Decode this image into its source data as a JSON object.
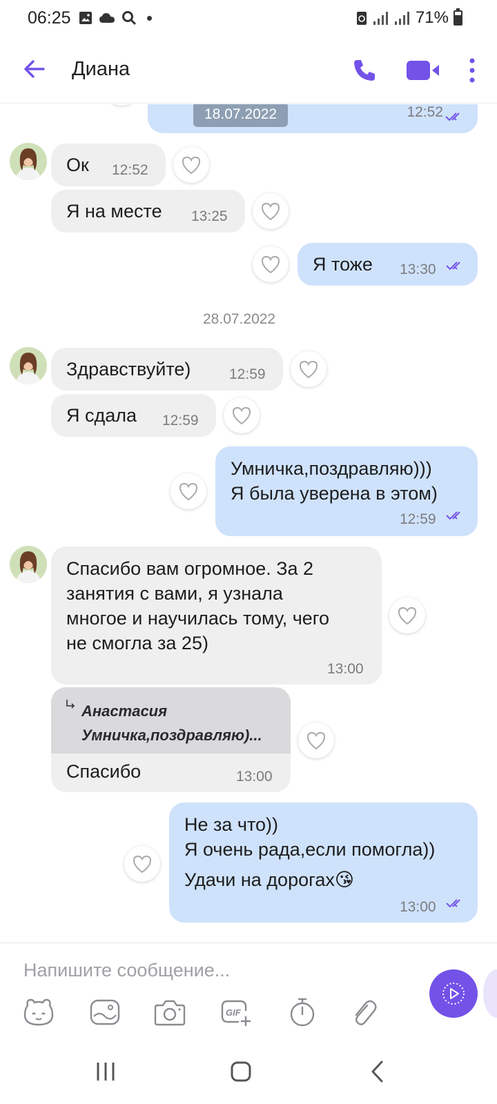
{
  "status_bar": {
    "time": "06:25",
    "battery": "71%",
    "battery_level": 0.71
  },
  "header": {
    "contact_name": "Диана"
  },
  "chat": {
    "top_partial_time": "12:52",
    "date_pill": "18.07.2022",
    "date_separator": "28.07.2022",
    "messages": [
      {
        "text": "Ок",
        "time": "12:52"
      },
      {
        "text": "Я на месте",
        "time": "13:25"
      },
      {
        "text": "Я тоже",
        "time": "13:30"
      },
      {
        "text": "Здравствуйте)",
        "time": "12:59"
      },
      {
        "text": "Я сдала",
        "time": "12:59"
      },
      {
        "lines": [
          "Умничка,поздравляю)))",
          "Я была уверена в этом)"
        ],
        "time": "12:59"
      },
      {
        "lines": [
          "Спасибо вам огромное. За 2",
          "занятия с вами, я узнала",
          "многое и научилась тому, чего",
          "не смогла за 25)"
        ],
        "time": "13:00"
      },
      {
        "reply_author": "Анастасия",
        "reply_preview": "Умничка,поздравляю)...",
        "text": "Спасибо",
        "time": "13:00"
      },
      {
        "lines": [
          "Не за что))",
          "Я очень рада,если помогла))",
          "Удачи на дорогах"
        ],
        "emoji": "😘",
        "time": "13:00"
      }
    ]
  },
  "composer": {
    "placeholder": "Напишите сообщение..."
  },
  "colors": {
    "accent": "#7352e8",
    "incoming": "#efefef",
    "outgoing": "#cfe2fb",
    "date_pill": "#8e9fb3"
  }
}
